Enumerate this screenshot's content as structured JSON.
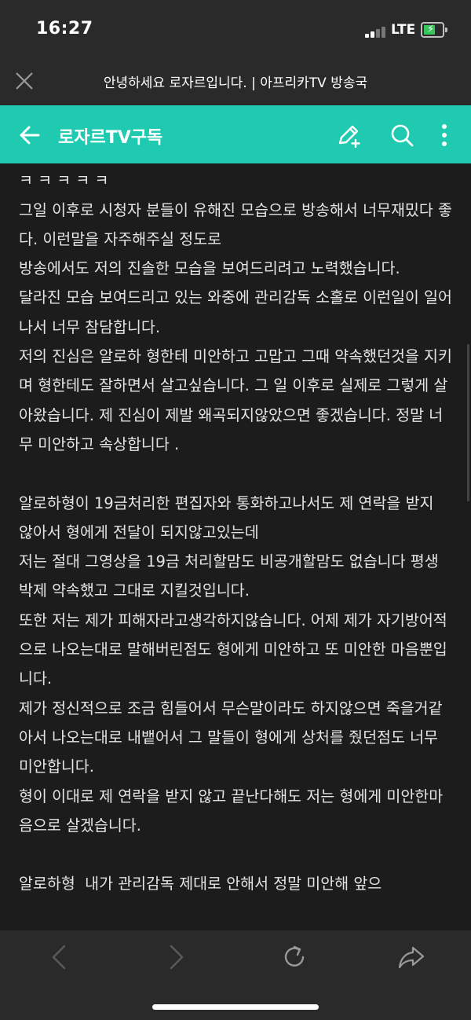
{
  "status_bar": {
    "time": "16:27",
    "network": "LTE",
    "battery_icon": "battery-charging-icon",
    "signal_icon": "signal-bars-icon"
  },
  "browser_bar": {
    "page_title": "안녕하세요 로자르입니다. | 아프리카TV 방송국",
    "close_icon": "close-icon"
  },
  "app_bar": {
    "title": "로자르TV구독",
    "accent_color": "#1fcab0",
    "icons": [
      "back-arrow-icon",
      "edit-add-icon",
      "search-icon",
      "more-vertical-icon"
    ]
  },
  "article": {
    "partial_top_line": "ㅋ ㅋ ㅋ ㅋ ㅋ",
    "paragraphs": [
      "그일 이후로 시청자 분들이 유해진 모습으로 방송해서 너무재밌다 좋다. 이런말을 자주해주실 정도로\n방송에서도 저의 진솔한 모습을 보여드리려고 노력했습니다.\n달라진 모습 보여드리고 있는 와중에 관리감독 소홀로 이런일이 일어나서 너무 참담합니다.\n저의 진심은 알로하 형한테 미안하고 고맙고 그때 약속했던것을 지키며 형한테도 잘하면서 살고싶습니다. 그 일 이후로 실제로 그렇게 살아왔습니다. 제 진심이 제발 왜곡되지않았으면 좋겠습니다. 정말 너무 미안하고 속상합니다 .",
      "알로하형이 19금처리한 편집자와 통화하고나서도 제 연락을 받지 않아서 형에게 전달이 되지않고있는데\n저는 절대 그영상을 19금 처리할맘도 비공개할맘도 없습니다 평생 박제 약속했고 그대로 지킬것입니다.\n또한 저는 제가 피해자라고생각하지않습니다. 어제 제가 자기방어적으로 나오는대로 말해버린점도 형에게 미안하고 또 미안한 마음뿐입니다.\n제가 정신적으로 조금 힘들어서 무슨말이라도 하지않으면 죽을거같아서 나오는대로 내뱉어서 그 말들이 형에게 상처를 줬던점도 너무 미안합니다.\n형이 이대로 제 연락을 받지 않고 끝난다해도 저는 형에게 미안한마음으로 살겠습니다.",
      "알로하형  내가 관리감독 제대로 안해서 정말 미안해 앞으"
    ]
  },
  "bottom_nav": {
    "icons": [
      "back-icon",
      "forward-icon",
      "refresh-icon",
      "share-icon"
    ]
  }
}
